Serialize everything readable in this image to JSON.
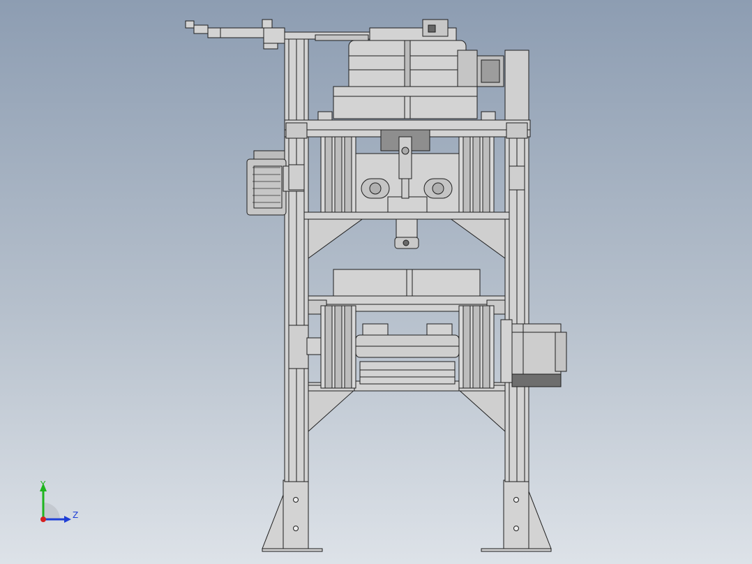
{
  "viewport": {
    "background_top": "#8d9db2",
    "background_bottom": "#dde2e8"
  },
  "model": {
    "description_icon": "cad-assembly-front-view",
    "line_color": "#1e1e1e",
    "body_color": "#d3d3d3",
    "dark_part_color": "#8f8f8f",
    "motor_color": "#bfbfbf"
  },
  "triad": {
    "y_label": "Y",
    "z_label": "Z",
    "y_color": "#1fb51f",
    "z_color": "#1f3fd6",
    "x_color": "#d62020"
  }
}
